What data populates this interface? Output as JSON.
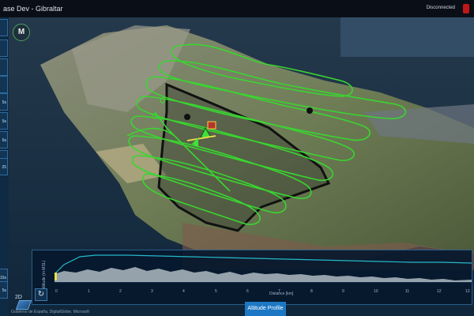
{
  "window": {
    "title": "ase Dev  - Gibraltar",
    "connection_status": "Disconnected"
  },
  "sidebar": {
    "buttons": [
      "",
      "",
      "",
      "",
      "5s",
      "5s",
      "6s",
      "",
      "25",
      "15s",
      "5s"
    ]
  },
  "map": {
    "logo_text": "M",
    "view_mode": "2D",
    "attribution": "Gobierno de España, DigitalGlobe, Microsoft"
  },
  "altitude_panel": {
    "ylabel": "Altitude (m MSL)",
    "xlabel": "Distance [km]",
    "x_ticks": [
      "0",
      "1",
      "2",
      "3",
      "4",
      "5",
      "6",
      "7",
      "8",
      "9",
      "10",
      "11",
      "12",
      "13"
    ],
    "y_ticks": [
      "",
      ""
    ],
    "tab_label": "Altitude Profile",
    "refresh_icon": "refresh-icon"
  },
  "colors": {
    "flight_path": "#39d630",
    "polygon": "#111111",
    "accent": "#1c78c4",
    "profile_line": "#26b8c9"
  }
}
